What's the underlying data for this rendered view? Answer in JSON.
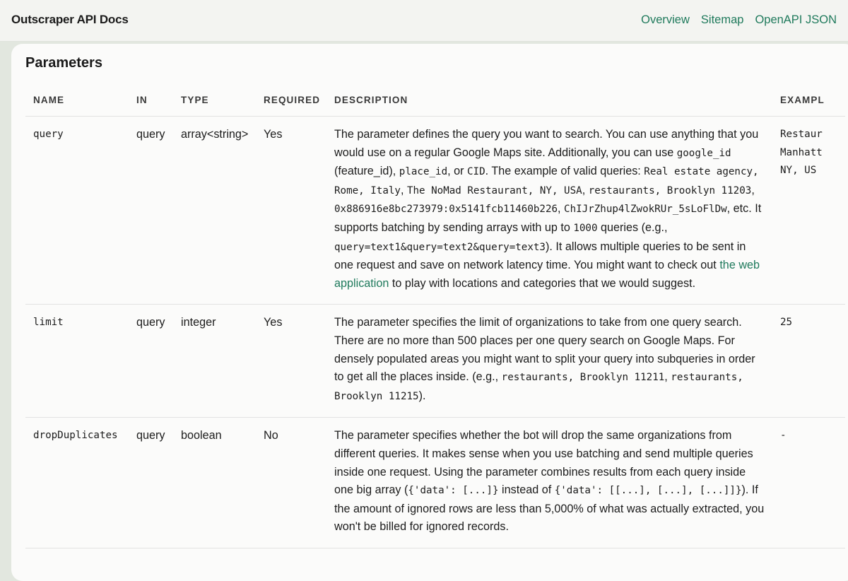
{
  "header": {
    "brand": "Outscraper API Docs",
    "nav": [
      "Overview",
      "Sitemap",
      "OpenAPI JSON"
    ]
  },
  "section": {
    "title": "Parameters"
  },
  "table": {
    "columns": [
      "NAME",
      "IN",
      "TYPE",
      "REQUIRED",
      "DESCRIPTION",
      "EXAMPL"
    ],
    "rows": [
      {
        "name": "query",
        "in": "query",
        "type": "array<string>",
        "required": "Yes",
        "description": [
          {
            "t": "text",
            "v": "The parameter defines the query you want to search. You can use anything that you would use on a regular Google Maps site. Additionally, you can use "
          },
          {
            "t": "code",
            "v": "google_id"
          },
          {
            "t": "text",
            "v": " (feature_id), "
          },
          {
            "t": "code",
            "v": "place_id"
          },
          {
            "t": "text",
            "v": ", or "
          },
          {
            "t": "code",
            "v": "CID"
          },
          {
            "t": "text",
            "v": ". The example of valid queries: "
          },
          {
            "t": "code",
            "v": "Real estate agency, Rome, Italy"
          },
          {
            "t": "text",
            "v": ", "
          },
          {
            "t": "code",
            "v": "The NoMad Restaurant, NY, USA"
          },
          {
            "t": "text",
            "v": ", "
          },
          {
            "t": "code",
            "v": "restaurants, Brooklyn 11203"
          },
          {
            "t": "text",
            "v": ", "
          },
          {
            "t": "code",
            "v": "0x886916e8bc273979:0x5141fcb11460b226"
          },
          {
            "t": "text",
            "v": ", "
          },
          {
            "t": "code",
            "v": "ChIJrZhup4lZwokRUr_5sLoFlDw"
          },
          {
            "t": "text",
            "v": ", etc. It supports batching by sending arrays with up to "
          },
          {
            "t": "code",
            "v": "1000"
          },
          {
            "t": "text",
            "v": " queries (e.g., "
          },
          {
            "t": "code",
            "v": "query=text1&query=text2&query=text3"
          },
          {
            "t": "text",
            "v": "). It allows multiple queries to be sent in one request and save on network latency time. You might want to check out "
          },
          {
            "t": "link",
            "v": "the web application"
          },
          {
            "t": "text",
            "v": " to play with locations and categories that we would suggest."
          }
        ],
        "example": [
          "Restaur",
          "Manhatt",
          "NY, US"
        ]
      },
      {
        "name": "limit",
        "in": "query",
        "type": "integer",
        "required": "Yes",
        "description": [
          {
            "t": "text",
            "v": "The parameter specifies the limit of organizations to take from one query search. There are no more than 500 places per one query search on Google Maps. For densely populated areas you might want to split your query into subqueries in order to get all the places inside. (e.g., "
          },
          {
            "t": "code",
            "v": "restaurants, Brooklyn 11211"
          },
          {
            "t": "text",
            "v": ", "
          },
          {
            "t": "code",
            "v": "restaurants, Brooklyn 11215"
          },
          {
            "t": "text",
            "v": ")."
          }
        ],
        "example": [
          "25"
        ]
      },
      {
        "name": "dropDuplicates",
        "in": "query",
        "type": "boolean",
        "required": "No",
        "description": [
          {
            "t": "text",
            "v": "The parameter specifies whether the bot will drop the same organizations from different queries. It makes sense when you use batching and send multiple queries inside one request. Using the parameter combines results from each query inside one big array ("
          },
          {
            "t": "code",
            "v": "{'data': [...]}"
          },
          {
            "t": "text",
            "v": " instead of "
          },
          {
            "t": "code",
            "v": "{'data': [[...], [...], [...]]}"
          },
          {
            "t": "text",
            "v": "). If the amount of ignored rows are less than 5,000% of what was actually extracted, you won't be billed for ignored records."
          }
        ],
        "example": [
          "-"
        ]
      }
    ]
  }
}
